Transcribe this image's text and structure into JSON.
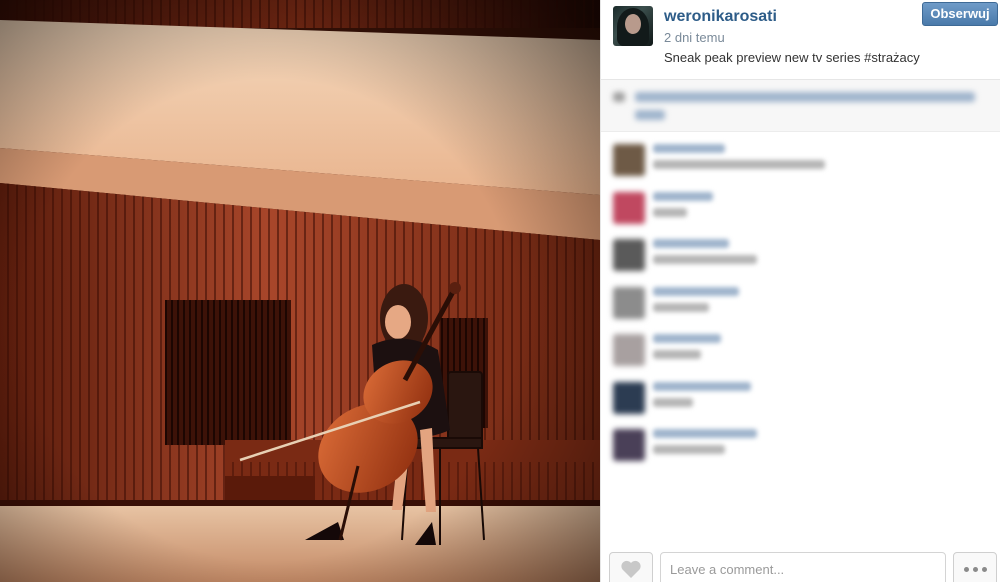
{
  "post": {
    "username": "weronikarosati",
    "time_ago": "2 dni temu",
    "caption": "Sneak peak preview new tv series #strażacy",
    "follow_label": "Obserwuj"
  },
  "photo": {
    "subject": "cellist-on-stage"
  },
  "comments": {
    "count": 7,
    "blurred": true,
    "avatar_colors": [
      "#6e5a46",
      "#c04860",
      "#5a5a5a",
      "#8c8c8c",
      "#a8a0a0",
      "#2c3c52",
      "#4a4058"
    ]
  },
  "footer": {
    "comment_placeholder": "Leave a comment...",
    "like_icon": "heart-icon",
    "more_icon": "ellipsis-icon"
  },
  "colors": {
    "username": "#2d5c88",
    "follow_button": "#5a88b8"
  }
}
